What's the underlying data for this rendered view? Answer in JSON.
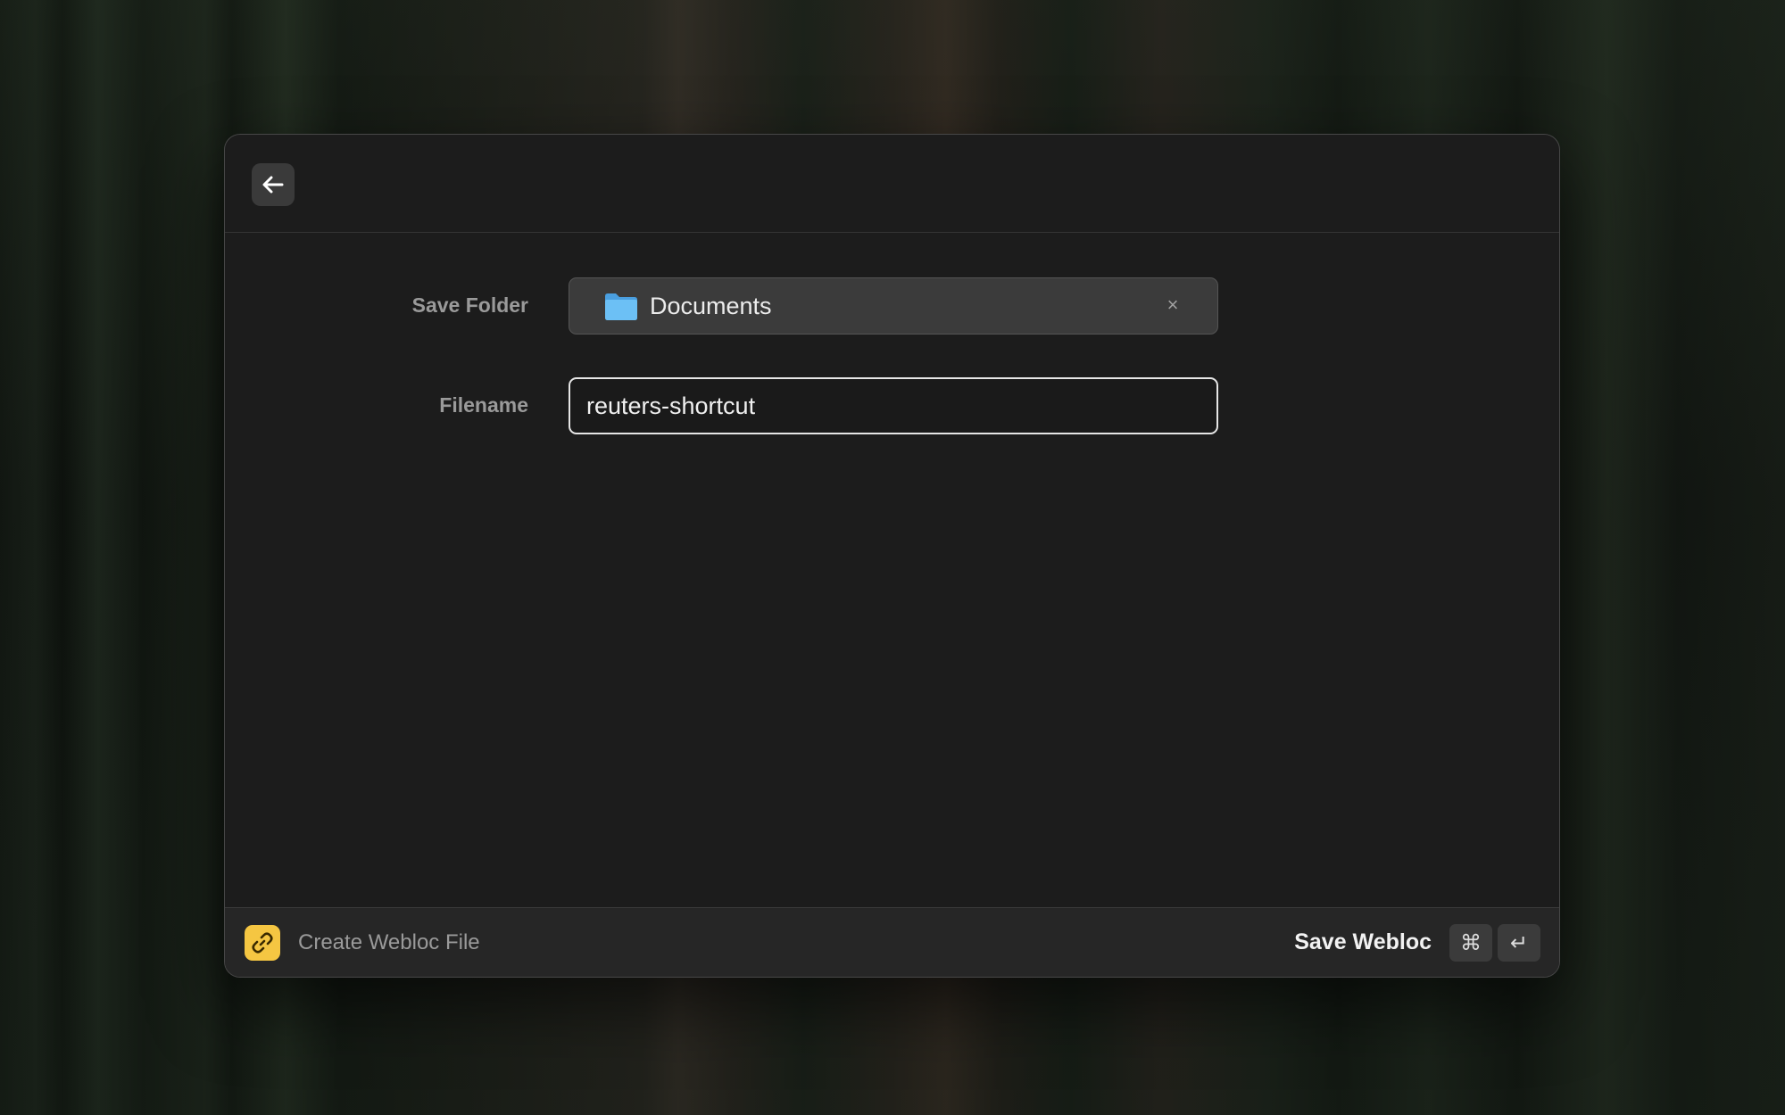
{
  "form": {
    "save_folder_label": "Save Folder",
    "save_folder_value": "Documents",
    "clear_symbol": "×",
    "filename_label": "Filename",
    "filename_value": "reuters-shortcut"
  },
  "footer": {
    "extension_title": "Create Webloc File",
    "action_label": "Save Webloc",
    "shortcut_modifier": "⌘",
    "shortcut_key": "↵"
  },
  "colors": {
    "window_bg": "#1c1c1c",
    "extension_icon_bg": "#f5c642",
    "folder_icon": "#5db4f0"
  },
  "icons": {
    "back": "arrow-left-icon",
    "folder": "folder-icon",
    "extension": "link-icon",
    "clear": "close-icon"
  }
}
